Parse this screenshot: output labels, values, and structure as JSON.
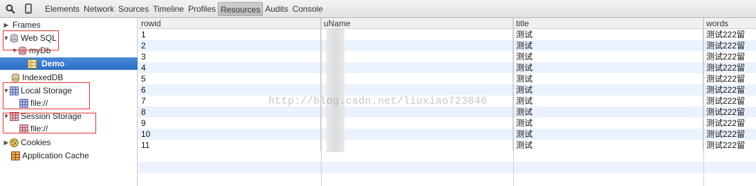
{
  "toolbar": {
    "tabs": [
      "Elements",
      "Network",
      "Sources",
      "Timeline",
      "Profiles",
      "Resources",
      "Audits",
      "Console"
    ],
    "active_tab": "Resources"
  },
  "sidebar": {
    "items": [
      {
        "label": "Frames"
      },
      {
        "label": "Web SQL"
      },
      {
        "label": "myDb"
      },
      {
        "label": "Demo"
      },
      {
        "label": "IndexedDB"
      },
      {
        "label": "Local Storage"
      },
      {
        "label": "file://"
      },
      {
        "label": "Session Storage"
      },
      {
        "label": "file://"
      },
      {
        "label": "Cookies"
      },
      {
        "label": "Application Cache"
      }
    ]
  },
  "table": {
    "columns": [
      "rowid",
      "uName",
      "title",
      "words"
    ],
    "rows": [
      [
        "1",
        "",
        "测试",
        "测试222留"
      ],
      [
        "2",
        "",
        "测试",
        "测试222留"
      ],
      [
        "3",
        "",
        "测试",
        "测试222留"
      ],
      [
        "4",
        "",
        "测试",
        "测试222留"
      ],
      [
        "5",
        "",
        "测试",
        "测试222留"
      ],
      [
        "6",
        "",
        "测试",
        "测试222留"
      ],
      [
        "7",
        "",
        "测试",
        "测试222留"
      ],
      [
        "8",
        "",
        "测试",
        "测试222留"
      ],
      [
        "9",
        "",
        "测试",
        "测试222留"
      ],
      [
        "10",
        "",
        "测试",
        "测试222留"
      ],
      [
        "11",
        "",
        "测试",
        "测试222留"
      ]
    ]
  },
  "watermark": "http://blog.csdn.net/liuxiao723846"
}
